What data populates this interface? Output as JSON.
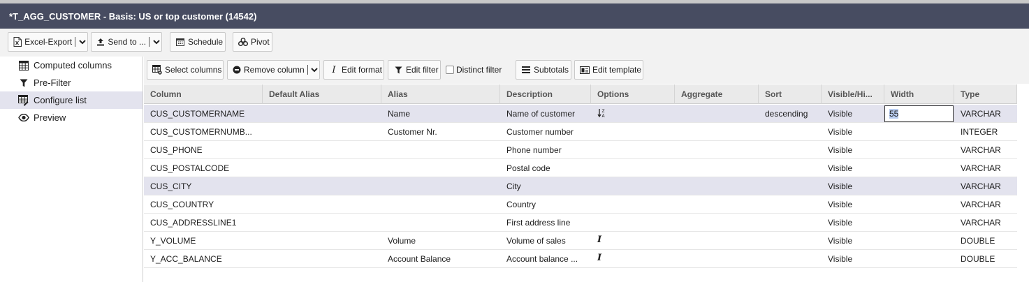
{
  "window": {
    "title": "*T_AGG_CUSTOMER - Basis: US or top customer (14542)"
  },
  "toolbar": {
    "excel_export": "Excel-Export",
    "send_to": "Send to ...",
    "schedule": "Schedule",
    "pivot": "Pivot"
  },
  "sidebar": {
    "items": [
      {
        "label": "Computed columns",
        "icon": "table-grid-icon"
      },
      {
        "label": "Pre-Filter",
        "icon": "filter-icon"
      },
      {
        "label": "Configure list",
        "icon": "configure-list-icon",
        "active": true
      },
      {
        "label": "Preview",
        "icon": "eye-icon"
      }
    ]
  },
  "list_toolbar": {
    "select_columns": "Select columns",
    "remove_column": "Remove column",
    "edit_format": "Edit format",
    "edit_filter": "Edit filter",
    "distinct_filter": "Distinct filter",
    "subtotals": "Subtotals",
    "edit_template": "Edit template"
  },
  "grid": {
    "headers": [
      "Column",
      "Default Alias",
      "Alias",
      "Description",
      "Options",
      "Aggregate",
      "Sort",
      "Visible/Hi...",
      "Width",
      "Type"
    ],
    "rows": [
      {
        "column": "CUS_CUSTOMERNAME",
        "default_alias": "",
        "alias": "Name",
        "description": "Name of customer",
        "options": "sort-az-icon",
        "aggregate": "",
        "sort": "descending",
        "visible": "Visible",
        "width": "55",
        "type": "VARCHAR"
      },
      {
        "column": "CUS_CUSTOMERNUMB...",
        "default_alias": "",
        "alias": "Customer Nr.",
        "description": "Customer number",
        "options": "",
        "aggregate": "",
        "sort": "",
        "visible": "Visible",
        "width": "",
        "type": "INTEGER"
      },
      {
        "column": "CUS_PHONE",
        "default_alias": "",
        "alias": "",
        "description": "Phone number",
        "options": "",
        "aggregate": "",
        "sort": "",
        "visible": "Visible",
        "width": "",
        "type": "VARCHAR"
      },
      {
        "column": "CUS_POSTALCODE",
        "default_alias": "",
        "alias": "",
        "description": "Postal code",
        "options": "",
        "aggregate": "",
        "sort": "",
        "visible": "Visible",
        "width": "",
        "type": "VARCHAR"
      },
      {
        "column": "CUS_CITY",
        "default_alias": "",
        "alias": "",
        "description": "City",
        "options": "",
        "aggregate": "",
        "sort": "",
        "visible": "Visible",
        "width": "",
        "type": "VARCHAR"
      },
      {
        "column": "CUS_COUNTRY",
        "default_alias": "",
        "alias": "",
        "description": "Country",
        "options": "",
        "aggregate": "",
        "sort": "",
        "visible": "Visible",
        "width": "",
        "type": "VARCHAR"
      },
      {
        "column": "CUS_ADDRESSLINE1",
        "default_alias": "",
        "alias": "",
        "description": "First address line",
        "options": "",
        "aggregate": "",
        "sort": "",
        "visible": "Visible",
        "width": "",
        "type": "VARCHAR"
      },
      {
        "column": "Y_VOLUME",
        "default_alias": "",
        "alias": "Volume",
        "description": "Volume of sales",
        "options": "format-italic-icon",
        "aggregate": "",
        "sort": "",
        "visible": "Visible",
        "width": "",
        "type": "DOUBLE"
      },
      {
        "column": "Y_ACC_BALANCE",
        "default_alias": "",
        "alias": "Account Balance",
        "description": "Account balance ...",
        "options": "format-italic-icon",
        "aggregate": "",
        "sort": "",
        "visible": "Visible",
        "width": "",
        "type": "DOUBLE"
      }
    ]
  },
  "colors": {
    "titlebar": "#474c61",
    "selected_row": "#e3e3ee",
    "toolbar": "#f2f2f2"
  }
}
